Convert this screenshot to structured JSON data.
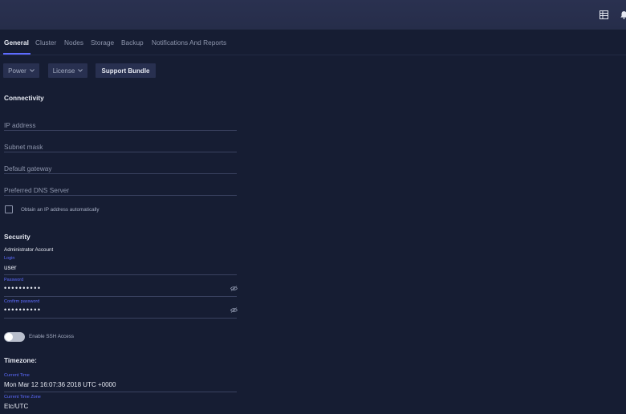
{
  "tabs": [
    {
      "label": "General",
      "active": true
    },
    {
      "label": "Cluster",
      "active": false
    },
    {
      "label": "Nodes",
      "active": false
    },
    {
      "label": "Storage",
      "active": false
    },
    {
      "label": "Backup",
      "active": false
    },
    {
      "label": "Notifications And Reports",
      "active": false
    }
  ],
  "toolbar": {
    "power_label": "Power",
    "license_label": "License",
    "support_bundle_label": "Support Bundle"
  },
  "connectivity": {
    "title": "Connectivity",
    "ip_address_placeholder": "IP address",
    "subnet_mask_placeholder": "Subnet mask",
    "default_gateway_placeholder": "Default gateway",
    "dns_server_placeholder": "Preferred DNS Server",
    "obtain_ip_label": "Obtain an IP address automatically",
    "obtain_ip_checked": false
  },
  "security": {
    "title": "Security",
    "admin_account_label": "Administrator Account",
    "login_label": "Login",
    "login_value": "user",
    "password_label": "Password",
    "password_value": "••••••••••",
    "confirm_password_label": "Confirm password",
    "confirm_password_value": "••••••••••",
    "ssh_label": "Enable SSH Access",
    "ssh_enabled": false
  },
  "timezone": {
    "title": "Timezone:",
    "current_time_label": "Current Time",
    "current_time_value": "Mon Mar 12 16:07:36 2018 UTC +0000",
    "current_zone_label": "Current Time Zone",
    "current_zone_value": "Etc/UTC"
  },
  "icons": {
    "topbar_right": [
      "list-icon",
      "bell-icon"
    ]
  },
  "colors": {
    "accent": "#5d6bff",
    "background": "#161d33"
  }
}
